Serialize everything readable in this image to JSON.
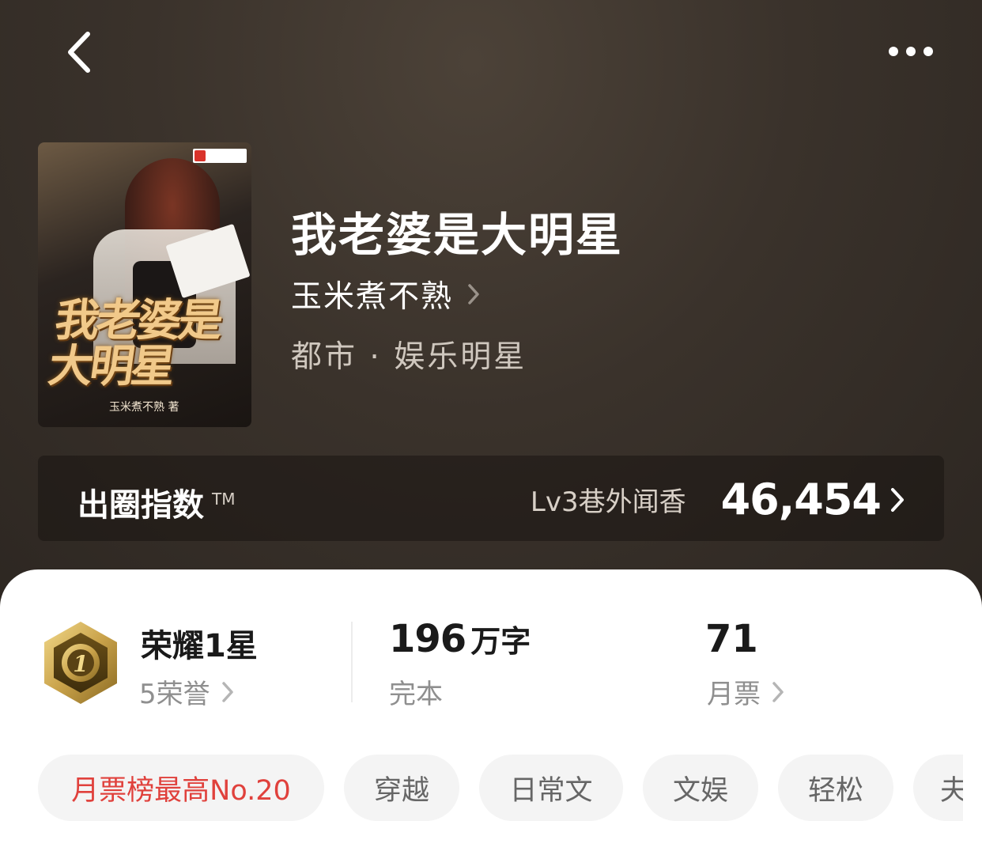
{
  "nav": {
    "back_icon": "chevron-left-icon",
    "more_icon": "more-horizontal-icon"
  },
  "book": {
    "title": "我老婆是大明星",
    "author": "玉米煮不熟",
    "category": "都市 · 娱乐明星",
    "cover": {
      "title_text": "我老婆是大明星",
      "author_text": "玉米煮不熟 著"
    }
  },
  "index": {
    "label": "出圈指数",
    "tm": "TM",
    "level": "Lv3巷外闻香",
    "score": "46,454"
  },
  "stats": {
    "honor": {
      "title": "荣耀1星",
      "sub": "5荣誉",
      "medal_number": "1"
    },
    "words": {
      "count": "196",
      "unit": "万字",
      "status": "完本"
    },
    "votes": {
      "count": "71",
      "label": "月票"
    }
  },
  "tags": [
    {
      "label": "月票榜最高No.20"
    },
    {
      "label": "穿越"
    },
    {
      "label": "日常文"
    },
    {
      "label": "文娱"
    },
    {
      "label": "轻松"
    },
    {
      "label": "夫"
    }
  ],
  "colors": {
    "hero_bg": "#3a322b",
    "hot_tag": "#e0413c",
    "medal_gold": "#c9a24a"
  }
}
